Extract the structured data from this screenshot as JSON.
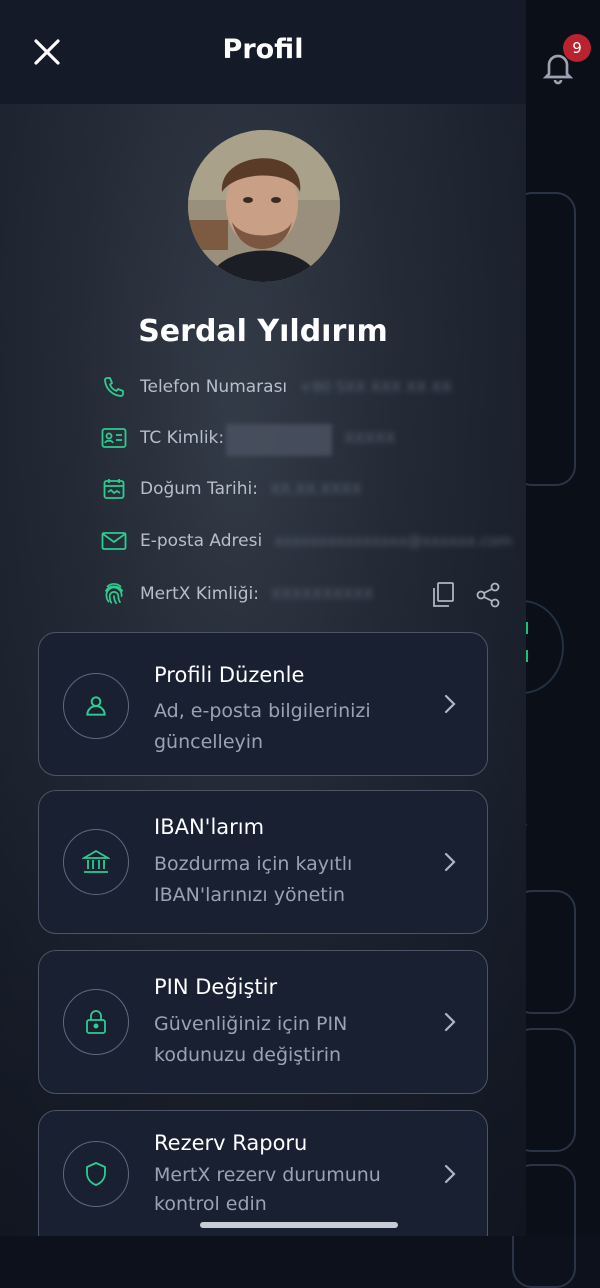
{
  "header": {
    "title": "Profil",
    "close_icon": "close-icon"
  },
  "notifications": {
    "badge_count": "9",
    "icon": "bell-icon"
  },
  "profile": {
    "name": "Serdal Yıldırım",
    "fields": [
      {
        "icon": "phone-icon",
        "label": "Telefon Numarası"
      },
      {
        "icon": "id-card-icon",
        "label": "TC Kimlik:"
      },
      {
        "icon": "calendar-icon",
        "label": "Doğum Tarihi:"
      },
      {
        "icon": "mail-icon",
        "label": "E-posta Adresi"
      },
      {
        "icon": "fingerprint-icon",
        "label": "MertX Kimliği:"
      }
    ],
    "actions": [
      "copy-icon",
      "share-icon"
    ]
  },
  "menu": [
    {
      "title": "Profili Düzenle",
      "subtitle": "Ad, e-posta bilgilerinizi güncelleyin",
      "icon": "user-icon"
    },
    {
      "title": "IBAN'larım",
      "subtitle": "Bozdurma için kayıtlı IBAN'larınızı yönetin",
      "icon": "bank-icon"
    },
    {
      "title": "PIN Değiştir",
      "subtitle": "Güvenliğiniz için PIN kodunuzu değiştirin",
      "icon": "lock-icon"
    },
    {
      "title": "Rezerv Raporu",
      "subtitle": "MertX rezerv durumunu kontrol edin",
      "icon": "shield-icon"
    }
  ],
  "colors": {
    "accent": "#2ecc8f",
    "card_bg": "#182032",
    "drawer_header": "#141a28"
  }
}
